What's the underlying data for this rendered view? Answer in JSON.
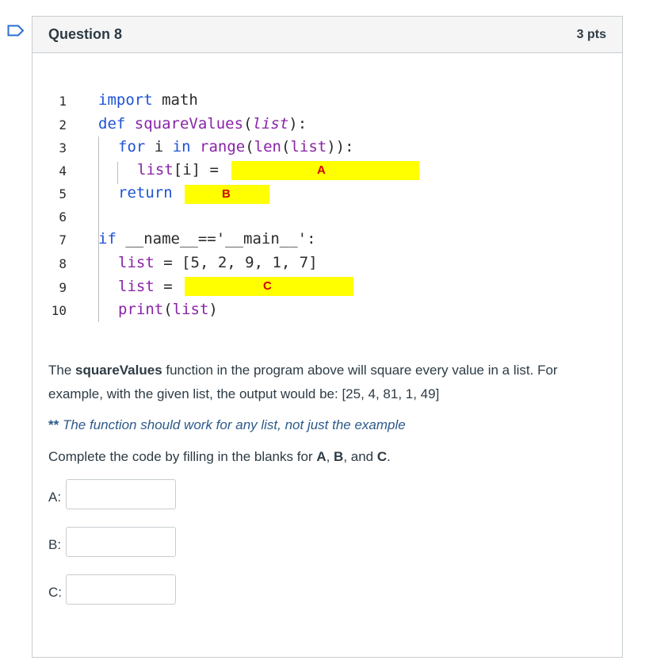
{
  "question": {
    "title": "Question 8",
    "points": "3 pts"
  },
  "code": {
    "line_numbers": [
      "1",
      "2",
      "3",
      "4",
      "5",
      "6",
      "7",
      "8",
      "9",
      "10"
    ],
    "lines": [
      {
        "parts": [
          {
            "t": "import",
            "c": "kw"
          },
          {
            "t": " math",
            "c": ""
          }
        ]
      },
      {
        "parts": [
          {
            "t": "def",
            "c": "kw"
          },
          {
            "t": " ",
            "c": ""
          },
          {
            "t": "squareValues",
            "c": "pl"
          },
          {
            "t": "(",
            "c": ""
          },
          {
            "t": "list",
            "c": "it"
          },
          {
            "t": "):",
            "c": ""
          }
        ]
      },
      {
        "parts": [
          {
            "t": "for",
            "c": "kw"
          },
          {
            "t": " i ",
            "c": ""
          },
          {
            "t": "in",
            "c": "kw"
          },
          {
            "t": " ",
            "c": ""
          },
          {
            "t": "range",
            "c": "pl"
          },
          {
            "t": "(",
            "c": ""
          },
          {
            "t": "len",
            "c": "pl"
          },
          {
            "t": "(",
            "c": ""
          },
          {
            "t": "list",
            "c": "pl"
          },
          {
            "t": ")):",
            "c": ""
          }
        ]
      },
      {
        "parts": [
          {
            "t": "list",
            "c": "pl"
          },
          {
            "t": "[i] ",
            "c": ""
          },
          {
            "t": "=",
            "c": ""
          }
        ]
      },
      {
        "parts": [
          {
            "t": "return",
            "c": "kw"
          }
        ]
      },
      {
        "parts": []
      },
      {
        "parts": [
          {
            "t": "if",
            "c": "kw"
          },
          {
            "t": " __name__=='__main__':",
            "c": ""
          }
        ]
      },
      {
        "parts": [
          {
            "t": "list",
            "c": "pl"
          },
          {
            "t": " = [5, 2, 9, 1, 7]",
            "c": ""
          }
        ]
      },
      {
        "parts": [
          {
            "t": "list",
            "c": "pl"
          },
          {
            "t": " =",
            "c": ""
          }
        ]
      },
      {
        "parts": [
          {
            "t": "print",
            "c": "pl"
          },
          {
            "t": "(",
            "c": ""
          },
          {
            "t": "list",
            "c": "pl"
          },
          {
            "t": ")",
            "c": ""
          }
        ]
      }
    ],
    "blanks": {
      "a": "A",
      "b": "B",
      "c": "C"
    }
  },
  "prompt": {
    "line1_pre": "The ",
    "line1_bold": "squareValues",
    "line1_post": " function in the program above will square every value in a list. For",
    "line2": "example, with the given list, the output would be: [25, 4, 81, 1, 49]",
    "note_stars": "**",
    "note_text": " The function should work for any list, not just the example",
    "complete_pre": "Complete the code by filling in the blanks for ",
    "complete_a": "A",
    "complete_sep1": ", ",
    "complete_b": "B",
    "complete_sep2": ", and ",
    "complete_c": "C",
    "complete_end": "."
  },
  "answers": [
    {
      "label": "A:",
      "value": ""
    },
    {
      "label": "B:",
      "value": ""
    },
    {
      "label": "C:",
      "value": ""
    }
  ],
  "colors": {
    "keyword": "#1f53d6",
    "identifier": "#8a23a8",
    "highlight": "#ffff00",
    "blank_letter": "#d00000",
    "note": "#2d5a8a"
  }
}
